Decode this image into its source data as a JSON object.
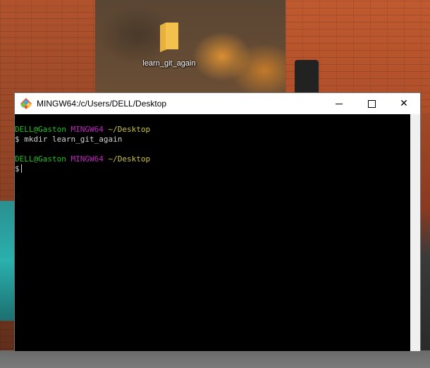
{
  "desktop": {
    "icons": [
      {
        "label": "learn_git_again",
        "icon": "folder-icon",
        "color": "#f2c14e"
      }
    ]
  },
  "window": {
    "title": "MINGW64:/c/Users/DELL/Desktop",
    "controls": {
      "minimize": "minimize",
      "maximize": "maximize",
      "close": "✕"
    }
  },
  "terminal": {
    "colors": {
      "user": "#22c022",
      "system": "#c026c0",
      "path": "#c8c34a",
      "text": "#d3d3d3",
      "background": "#000000"
    },
    "blocks": [
      {
        "user": "DELL@Gaston",
        "system": "MINGW64",
        "path": "~/Desktop",
        "prompt": "$",
        "command": "mkdir learn_git_again"
      },
      {
        "user": "DELL@Gaston",
        "system": "MINGW64",
        "path": "~/Desktop",
        "prompt": "$",
        "command": ""
      }
    ]
  }
}
